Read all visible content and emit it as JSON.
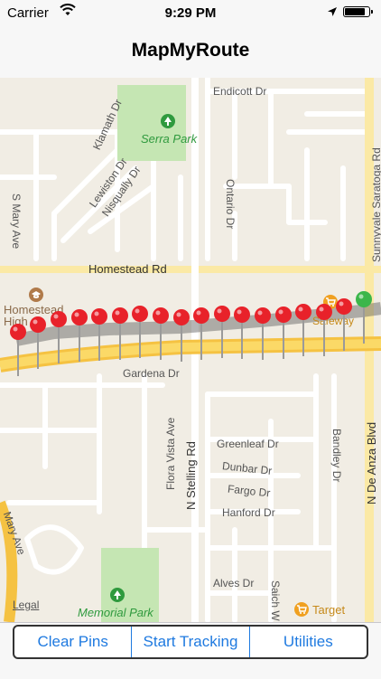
{
  "status_bar": {
    "carrier": "Carrier",
    "time": "9:29 PM",
    "battery_level": 0.9
  },
  "nav": {
    "title": "MapMyRoute"
  },
  "map": {
    "streets": [
      {
        "id": "endicott",
        "label": "Endicott Dr"
      },
      {
        "id": "klamath",
        "label": "Klamath Dr"
      },
      {
        "id": "lewiston",
        "label": "Lewiston Dr"
      },
      {
        "id": "nisqually",
        "label": "Nisqually Dr"
      },
      {
        "id": "ontario",
        "label": "Ontario Dr"
      },
      {
        "id": "s-mary",
        "label": "S Mary Ave"
      },
      {
        "id": "sunnyvale",
        "label": "Sunnyvale Saratoga Rd"
      },
      {
        "id": "homestead",
        "label": "Homestead Rd"
      },
      {
        "id": "gardena",
        "label": "Gardena Dr"
      },
      {
        "id": "flora",
        "label": "Flora Vista Ave"
      },
      {
        "id": "stelling",
        "label": "N Stelling Rd"
      },
      {
        "id": "greenleaf",
        "label": "Greenleaf Dr"
      },
      {
        "id": "dunbar",
        "label": "Dunbar Dr"
      },
      {
        "id": "fargo",
        "label": "Fargo Dr"
      },
      {
        "id": "hanford",
        "label": "Hanford Dr"
      },
      {
        "id": "bandley",
        "label": "Bandley Dr"
      },
      {
        "id": "deanza",
        "label": "N De Anza Blvd"
      },
      {
        "id": "mary",
        "label": "Mary Ave"
      },
      {
        "id": "alves",
        "label": "Alves Dr"
      },
      {
        "id": "saich",
        "label": "Saich W"
      }
    ],
    "places": {
      "serra_park": "Serra Park",
      "homestead_high": "Homestead High",
      "safeway": "Safeway",
      "memorial_park": "Memorial Park",
      "target": "Target"
    },
    "legal": "Legal"
  },
  "toolbar": {
    "clear_pins": "Clear Pins",
    "start_tracking": "Start Tracking",
    "utilities": "Utilities"
  }
}
